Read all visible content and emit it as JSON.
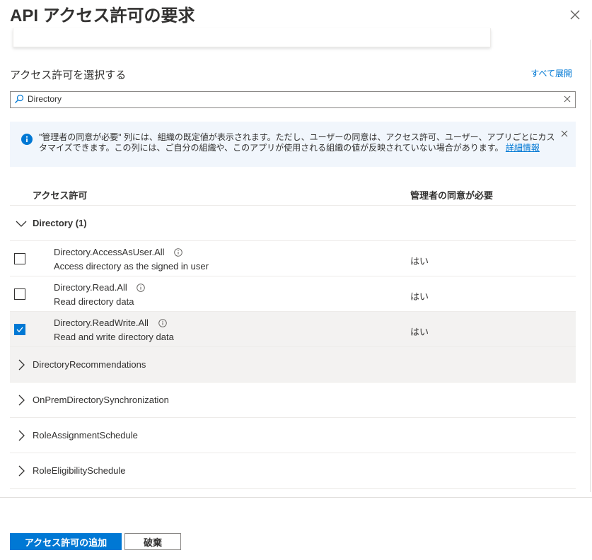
{
  "header": {
    "title": "API アクセス許可の要求"
  },
  "permissions_section": {
    "label": "アクセス許可を選択する",
    "expand_all": "すべて展開"
  },
  "search": {
    "value": "Directory",
    "placeholder": ""
  },
  "info_bar": {
    "message": "\"管理者の同意が必要\" 列には、組織の既定値が表示されます。ただし、ユーザーの同意は、アクセス許可、ユーザー、アプリごとにカスタマイズできます。この列には、ご自分の組織や、このアプリが使用される組織の値が反映されていない場合があります。",
    "link": "詳細情報"
  },
  "table": {
    "columns": {
      "permission": "アクセス許可",
      "admin_consent": "管理者の同意が必要"
    },
    "expanded_group": {
      "label": "Directory (1)",
      "items": [
        {
          "name": "Directory.AccessAsUser.All",
          "description": "Access directory as the signed in user",
          "admin_consent": "はい",
          "checked": false
        },
        {
          "name": "Directory.Read.All",
          "description": "Read directory data",
          "admin_consent": "はい",
          "checked": false
        },
        {
          "name": "Directory.ReadWrite.All",
          "description": "Read and write directory data",
          "admin_consent": "はい",
          "checked": true
        }
      ]
    },
    "collapsed_groups": [
      {
        "label": "DirectoryRecommendations"
      },
      {
        "label": "OnPremDirectorySynchronization"
      },
      {
        "label": "RoleAssignmentSchedule"
      },
      {
        "label": "RoleEligibilitySchedule"
      }
    ]
  },
  "footer": {
    "add_button": "アクセス許可の追加",
    "discard_button": "破棄"
  },
  "colors": {
    "accent": "#0078d4",
    "info_bg": "#f1f6fc",
    "selected_row": "#f3f2f1",
    "border": "#edebe9"
  },
  "icons": [
    "close-icon",
    "search-icon",
    "clear-icon",
    "info-icon",
    "dismiss-icon",
    "chevron-down-icon",
    "chevron-right-icon",
    "info-circle-icon",
    "checkmark-icon"
  ]
}
